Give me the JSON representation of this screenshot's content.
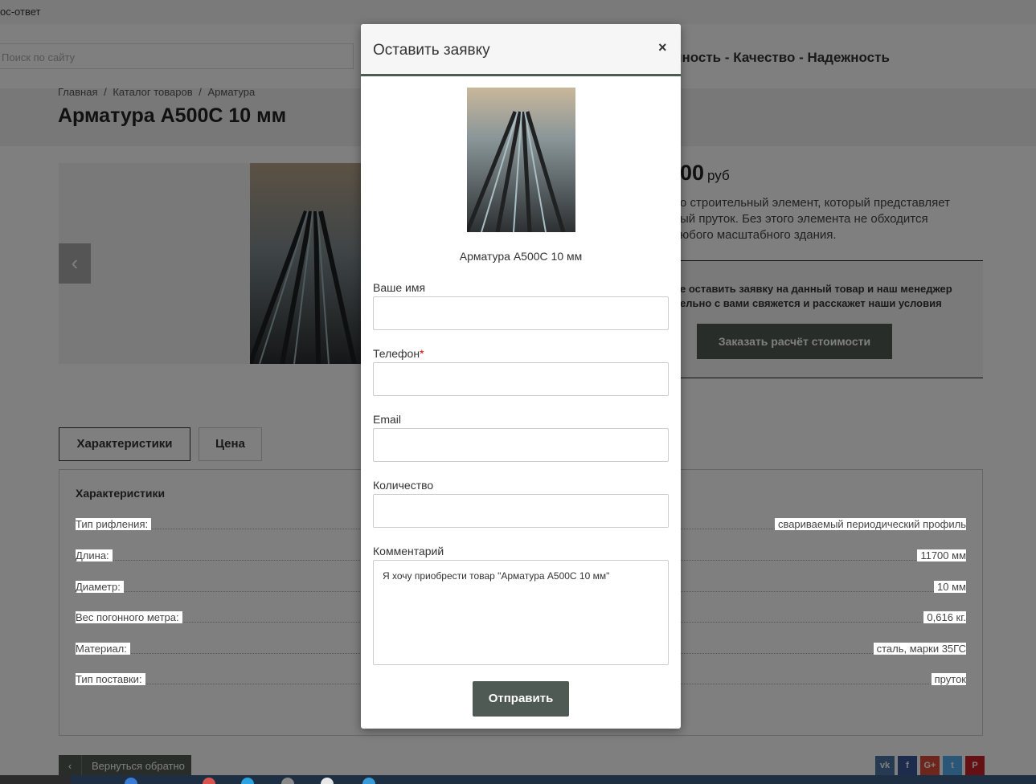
{
  "topbar": {
    "link": "ос-ответ"
  },
  "header": {
    "search_placeholder": "Поиск по сайту",
    "slogan": "тупность - Качество - Надежность"
  },
  "breadcrumb": [
    "Главная",
    "/",
    "Каталог товаров",
    "/",
    "Арматура"
  ],
  "product": {
    "title": "Арматура А500С 10 мм",
    "price": "00",
    "currency": "руб",
    "desc_lines": [
      "о строительный элемент, который представляет",
      "ый пруток. Без этого элемента не обходится",
      "юбого масштабного здания."
    ],
    "order_lines": [
      "е оставить заявку на данный товар и наш менеджер",
      "ельно с вами свяжется и расскажет наши условия"
    ],
    "order_button": "Заказать расчёт стоимости"
  },
  "tabs": [
    "Характеристики",
    "Цена"
  ],
  "specs": {
    "heading": "Характеристики",
    "rows": [
      {
        "k": "Тип рифления:",
        "v": "свариваемый периодический профиль"
      },
      {
        "k": "Длина:",
        "v": "11700 мм"
      },
      {
        "k": "Диаметр:",
        "v": "10 мм"
      },
      {
        "k": "Вес погонного метра:",
        "v": "0,616 кг."
      },
      {
        "k": "Материал:",
        "v": "сталь, марки 35ГС"
      },
      {
        "k": "Тип поставки:",
        "v": "пруток"
      }
    ]
  },
  "back_button": "Вернуться обратно",
  "social": [
    {
      "icon": "vk-icon",
      "glyph": "vk",
      "color": "#4c75a3"
    },
    {
      "icon": "facebook-icon",
      "glyph": "f",
      "color": "#3b5998"
    },
    {
      "icon": "google-plus-icon",
      "glyph": "G+",
      "color": "#dd4b39"
    },
    {
      "icon": "twitter-icon",
      "glyph": "t",
      "color": "#55acee"
    },
    {
      "icon": "pinterest-icon",
      "glyph": "P",
      "color": "#cb2027"
    }
  ],
  "modal": {
    "title": "Оставить заявку",
    "close": "×",
    "product_name": "Арматура А500С 10 мм",
    "fields": [
      {
        "label": "Ваше имя",
        "required": false
      },
      {
        "label": "Телефон",
        "required": true
      },
      {
        "label": "Email",
        "required": false
      },
      {
        "label": "Количество",
        "required": false
      }
    ],
    "comment_label": "Комментарий",
    "comment_value": "Я хочу приобрести товар \"Арматура А500С 10 мм\"",
    "submit": "Отправить"
  },
  "colors": {
    "accent": "#505a55",
    "required": "#cc0000"
  }
}
